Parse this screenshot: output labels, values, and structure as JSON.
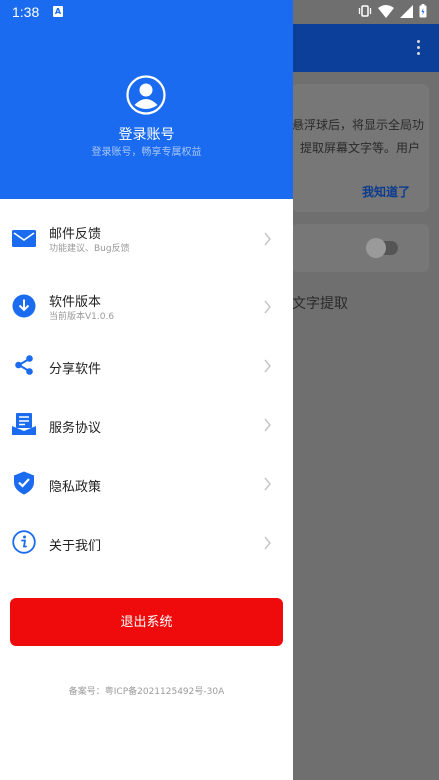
{
  "status_bar": {
    "time": "1:38",
    "app_badge": "A"
  },
  "background_app": {
    "card_line1": "悬浮球后，将显示全局功",
    "card_line2": "提取屏幕文字等。用户",
    "card_link": "我知道了",
    "feature_text": "文字提取"
  },
  "drawer": {
    "login_title": "登录账号",
    "login_subtitle": "登录账号，畅享专属权益",
    "menu": [
      {
        "label": "邮件反馈",
        "sub": "功能建议、Bug反馈",
        "icon": "mail-icon"
      },
      {
        "label": "软件版本",
        "sub": "当前版本V1.0.6",
        "icon": "download-icon"
      },
      {
        "label": "分享软件",
        "sub": "",
        "icon": "share-icon"
      },
      {
        "label": "服务协议",
        "sub": "",
        "icon": "agreement-icon"
      },
      {
        "label": "隐私政策",
        "sub": "",
        "icon": "shield-icon"
      },
      {
        "label": "关于我们",
        "sub": "",
        "icon": "info-icon"
      }
    ],
    "logout_label": "退出系统",
    "icp": "备案号：粤ICP备2021125492号-30A"
  },
  "colors": {
    "primary": "#1a6bf0",
    "danger": "#ef0b0b",
    "scrim": "#6f6f6f"
  }
}
